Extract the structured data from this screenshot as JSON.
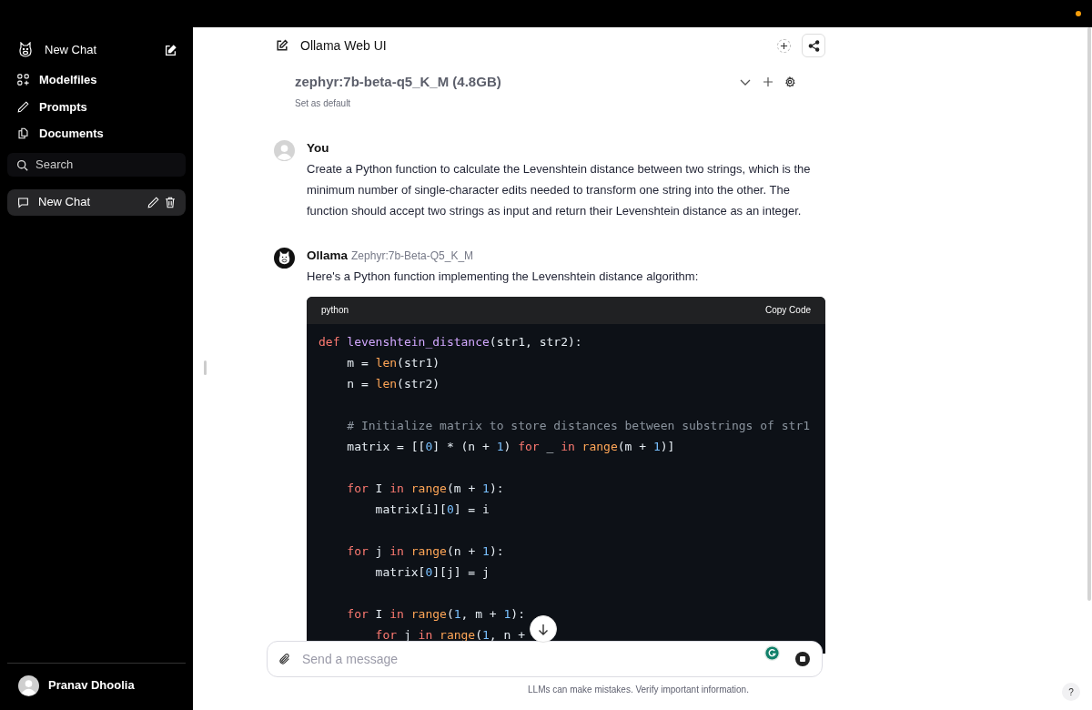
{
  "sidebar": {
    "new_chat": "New Chat",
    "nav": [
      {
        "label": "Modelfiles"
      },
      {
        "label": "Prompts"
      },
      {
        "label": "Documents"
      }
    ],
    "search": {
      "placeholder": "Search"
    },
    "chats": [
      {
        "title": "New Chat",
        "selected": true
      }
    ],
    "user": {
      "name": "Pranav Dhoolia"
    }
  },
  "header": {
    "title": "Ollama Web UI"
  },
  "model": {
    "name": "zephyr:7b-beta-q5_K_M (4.8GB)",
    "set_default": "Set as default"
  },
  "messages": [
    {
      "kind": "user",
      "author": "You",
      "text": "Create a Python function to calculate the Levenshtein distance between two strings, which is the minimum number of single-character edits needed to transform one string into the other. The function should accept two strings as input and return their Levenshtein distance as an integer."
    },
    {
      "kind": "assistant",
      "author": "Ollama",
      "model": "Zephyr:7b-Beta-Q5_K_M",
      "text": "Here's a Python function implementing the Levenshtein distance algorithm:",
      "code": {
        "language": "python",
        "copy": "Copy Code",
        "blocks": [
          [
            [
              {
                "t": "def ",
                "kind": "keyword"
              },
              {
                "t": "levenshtein_distance",
                "kind": "function"
              },
              {
                "t": "(str1, str2):",
                "kind": "plain"
              }
            ],
            [
              {
                "t": "    m = ",
                "kind": "plain"
              },
              {
                "t": "len",
                "kind": "builtin"
              },
              {
                "t": "(str1)",
                "kind": "plain"
              }
            ],
            [
              {
                "t": "    n = ",
                "kind": "plain"
              },
              {
                "t": "len",
                "kind": "builtin"
              },
              {
                "t": "(str2)",
                "kind": "plain"
              }
            ]
          ],
          [
            [
              {
                "t": "    # Initialize matrix to store distances between substrings of str1",
                "kind": "comment"
              }
            ],
            [
              {
                "t": "    matrix = [[",
                "kind": "plain"
              },
              {
                "t": "0",
                "kind": "number"
              },
              {
                "t": "] * (n + ",
                "kind": "plain"
              },
              {
                "t": "1",
                "kind": "number"
              },
              {
                "t": ") ",
                "kind": "plain"
              },
              {
                "t": "for",
                "kind": "keyword"
              },
              {
                "t": " _ ",
                "kind": "plain"
              },
              {
                "t": "in",
                "kind": "keyword"
              },
              {
                "t": " range",
                "kind": "builtin"
              },
              {
                "t": "(m + ",
                "kind": "plain"
              },
              {
                "t": "1",
                "kind": "number"
              },
              {
                "t": ")]",
                "kind": "plain"
              }
            ]
          ],
          [
            [
              {
                "t": "    for",
                "kind": "keyword"
              },
              {
                "t": " I ",
                "kind": "plain"
              },
              {
                "t": "in",
                "kind": "keyword"
              },
              {
                "t": " range",
                "kind": "builtin"
              },
              {
                "t": "(m + ",
                "kind": "plain"
              },
              {
                "t": "1",
                "kind": "number"
              },
              {
                "t": "):",
                "kind": "plain"
              }
            ],
            [
              {
                "t": "        matrix[i][",
                "kind": "plain"
              },
              {
                "t": "0",
                "kind": "number"
              },
              {
                "t": "] = i",
                "kind": "plain"
              }
            ]
          ],
          [
            [
              {
                "t": "    for",
                "kind": "keyword"
              },
              {
                "t": " j ",
                "kind": "plain"
              },
              {
                "t": "in",
                "kind": "keyword"
              },
              {
                "t": " range",
                "kind": "builtin"
              },
              {
                "t": "(n + ",
                "kind": "plain"
              },
              {
                "t": "1",
                "kind": "number"
              },
              {
                "t": "):",
                "kind": "plain"
              }
            ],
            [
              {
                "t": "        matrix[",
                "kind": "plain"
              },
              {
                "t": "0",
                "kind": "number"
              },
              {
                "t": "][j] = j",
                "kind": "plain"
              }
            ]
          ],
          [
            [
              {
                "t": "    for",
                "kind": "keyword"
              },
              {
                "t": " I ",
                "kind": "plain"
              },
              {
                "t": "in",
                "kind": "keyword"
              },
              {
                "t": " range",
                "kind": "builtin"
              },
              {
                "t": "(",
                "kind": "plain"
              },
              {
                "t": "1",
                "kind": "number"
              },
              {
                "t": ", m + ",
                "kind": "plain"
              },
              {
                "t": "1",
                "kind": "number"
              },
              {
                "t": "):",
                "kind": "plain"
              }
            ],
            [
              {
                "t": "        for",
                "kind": "keyword"
              },
              {
                "t": " j ",
                "kind": "plain"
              },
              {
                "t": "in",
                "kind": "keyword"
              },
              {
                "t": " range",
                "kind": "builtin"
              },
              {
                "t": "(",
                "kind": "plain"
              },
              {
                "t": "1",
                "kind": "number"
              },
              {
                "t": ", n +",
                "kind": "plain"
              }
            ]
          ]
        ]
      }
    }
  ],
  "composer": {
    "placeholder": "Send a message"
  },
  "footer": "LLMs can make mistakes. Verify important information.",
  "help": "?"
}
